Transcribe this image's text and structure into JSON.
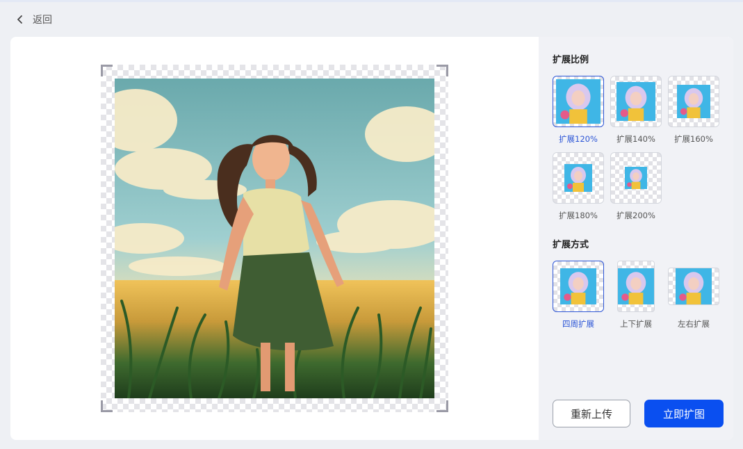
{
  "header": {
    "back_label": "返回"
  },
  "ratio": {
    "title": "扩展比例",
    "options": [
      {
        "label": "扩展120%",
        "selected": true
      },
      {
        "label": "扩展140%",
        "selected": false
      },
      {
        "label": "扩展160%",
        "selected": false
      },
      {
        "label": "扩展180%",
        "selected": false
      },
      {
        "label": "扩展200%",
        "selected": false
      }
    ]
  },
  "mode": {
    "title": "扩展方式",
    "options": [
      {
        "label": "四周扩展",
        "selected": true
      },
      {
        "label": "上下扩展",
        "selected": false
      },
      {
        "label": "左右扩展",
        "selected": false
      }
    ]
  },
  "buttons": {
    "reupload": "重新上传",
    "expand": "立即扩图"
  },
  "colors": {
    "accent": "#0a4ff0",
    "selected_text": "#2c55d6"
  }
}
